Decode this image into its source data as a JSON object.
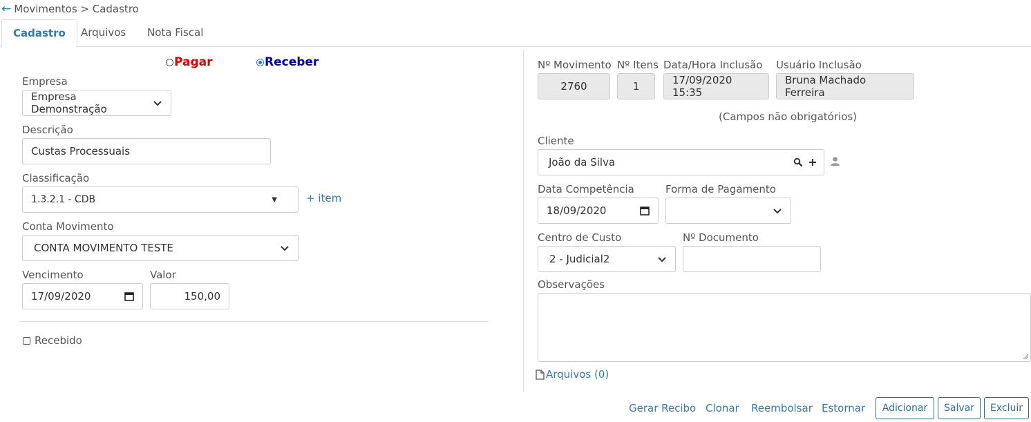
{
  "breadcrumb": {
    "text": "Movimentos > Cadastro"
  },
  "tabs": [
    {
      "label": "Cadastro",
      "active": true
    },
    {
      "label": "Arquivos",
      "active": false
    },
    {
      "label": "Nota Fiscal",
      "active": false
    }
  ],
  "type_radio": {
    "pagar": {
      "label": "Pagar",
      "color": "#e00000",
      "checked": false
    },
    "receber": {
      "label": "Receber",
      "color": "#0000b3",
      "checked": true
    }
  },
  "left": {
    "empresa": {
      "label": "Empresa",
      "value": "Empresa Demonstração"
    },
    "descricao": {
      "label": "Descrição",
      "value": "Custas Processuais"
    },
    "classificacao": {
      "label": "Classificação",
      "value": "1.3.2.1 - CDB",
      "add_link": "+ item"
    },
    "conta": {
      "label": "Conta Movimento",
      "value": "CONTA MOVIMENTO TESTE"
    },
    "vencimento": {
      "label": "Vencimento",
      "value": "17/09/2020"
    },
    "valor": {
      "label": "Valor",
      "value": "150,00"
    },
    "recebido": {
      "label": "Recebido",
      "checked": false
    }
  },
  "right": {
    "movimento": {
      "label": "Nº Movimento",
      "value": "2760"
    },
    "itens": {
      "label": "Nº Itens",
      "value": "1"
    },
    "data_inclusao": {
      "label": "Data/Hora Inclusão",
      "value": "17/09/2020 15:35"
    },
    "usuario": {
      "label": "Usuário Inclusão",
      "value": "Bruna Machado Ferreira"
    },
    "note": "(Campos não obrigatórios)",
    "cliente": {
      "label": "Cliente",
      "value": "João da Silva"
    },
    "competencia": {
      "label": "Data Competência",
      "value": "18/09/2020"
    },
    "forma": {
      "label": "Forma de Pagamento",
      "value": ""
    },
    "centro": {
      "label": "Centro de Custo",
      "value": "2 - Judicial2"
    },
    "documento": {
      "label": "Nº Documento",
      "value": ""
    },
    "observacoes": {
      "label": "Observações",
      "value": ""
    },
    "arquivos_link": "Arquivos (0)"
  },
  "actions": {
    "gerar_recibo": "Gerar Recibo",
    "clonar": "Clonar",
    "reembolsar": "Reembolsar",
    "estornar": "Estornar",
    "adicionar": "Adicionar",
    "salvar": "Salvar",
    "excluir": "Excluir"
  }
}
